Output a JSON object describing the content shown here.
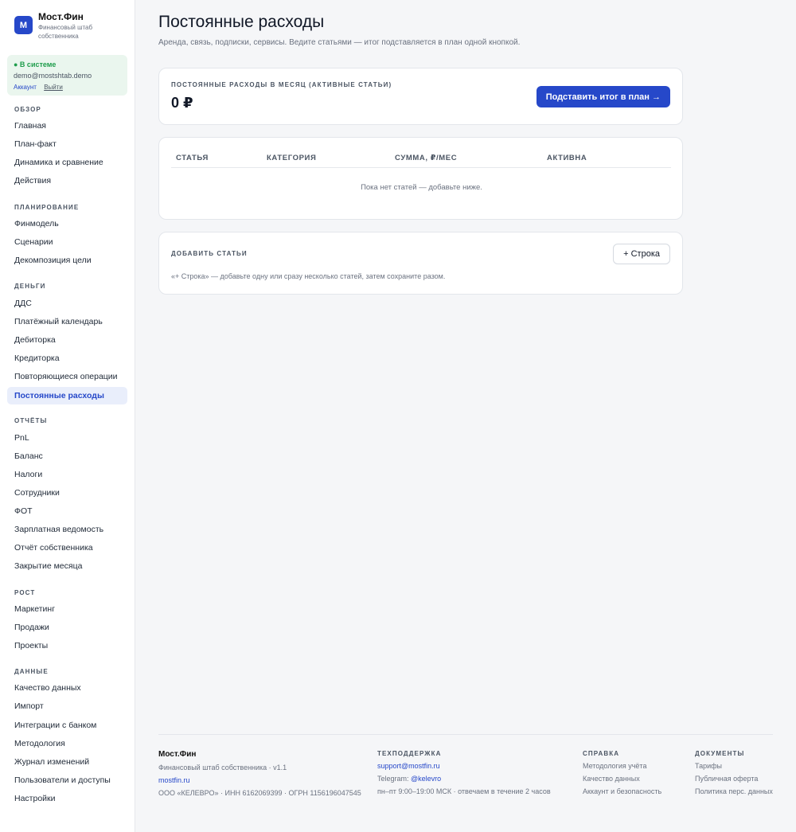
{
  "brand": {
    "logo_letter": "М",
    "name": "Мост.Фин",
    "subtitle": "Финансовый штаб собственника"
  },
  "session": {
    "status": "● В системе",
    "email": "demo@mostshtab.demo",
    "account_link": "Аккаунт",
    "logout_link": "Выйти"
  },
  "nav": {
    "overview": {
      "title": "Обзор",
      "items": [
        "Главная",
        "План-факт",
        "Динамика и сравнение",
        "Действия"
      ]
    },
    "planning": {
      "title": "Планирование",
      "items": [
        "Финмодель",
        "Сценарии",
        "Декомпозиция цели"
      ]
    },
    "money": {
      "title": "Деньги",
      "items": [
        "ДДС",
        "Платёжный календарь",
        "Дебиторка",
        "Кредиторка",
        "Повторяющиеся операции",
        "Постоянные расходы"
      ]
    },
    "reports": {
      "title": "Отчёты",
      "items": [
        "PnL",
        "Баланс",
        "Налоги",
        "Сотрудники",
        "ФОТ",
        "Зарплатная ведомость",
        "Отчёт собственника",
        "Закрытие месяца"
      ]
    },
    "growth": {
      "title": "Рост",
      "items": [
        "Маркетинг",
        "Продажи",
        "Проекты"
      ]
    },
    "data": {
      "title": "Данные",
      "items": [
        "Качество данных",
        "Импорт",
        "Интеграции с банком",
        "Методология",
        "Журнал изменений",
        "Пользователи и доступы",
        "Настройки"
      ]
    }
  },
  "page": {
    "title": "Постоянные расходы",
    "subtitle": "Аренда, связь, подписки, сервисы. Ведите статьями — итог подставляется в план одной кнопкой."
  },
  "summary": {
    "label": "Постоянные расходы в месяц (активные статьи)",
    "total": "0 ₽",
    "apply_button": "Подставить итог в план →"
  },
  "table": {
    "columns": [
      "Статья",
      "Категория",
      "Сумма, ₽/мес",
      "Активна"
    ],
    "empty_message": "Пока нет статей — добавьте ниже."
  },
  "add_card": {
    "label": "Добавить статьи",
    "add_row_button": "+ Строка",
    "hint": "«+ Строка» — добавьте одну или сразу несколько статей, затем сохраните разом."
  },
  "footer": {
    "brand": {
      "name": "Мост.Фин",
      "tagline": "Финансовый штаб собственника · v1.1",
      "site": "mostfin.ru",
      "legal": "ООО «КЕЛЕВРО» · ИНН 6162069399 · ОГРН 1156196047545"
    },
    "support": {
      "title": "Техподдержка",
      "email": "support@mostfin.ru",
      "telegram_label": "Telegram:",
      "telegram_handle": "@kelevro",
      "hours": "пн–пт 9:00–19:00 МСК · отвечаем в течение 2 часов"
    },
    "help": {
      "title": "Справка",
      "links": [
        "Методология учёта",
        "Качество данных",
        "Аккаунт и безопасность"
      ]
    },
    "docs": {
      "title": "Документы",
      "links": [
        "Тарифы",
        "Публичная оферта",
        "Политика перс. данных"
      ]
    }
  },
  "colors": {
    "accent": "#2648c9",
    "success": "#1f9d4c",
    "active_nav_bg": "#e9eefb",
    "page_bg": "#f5f6f8"
  }
}
